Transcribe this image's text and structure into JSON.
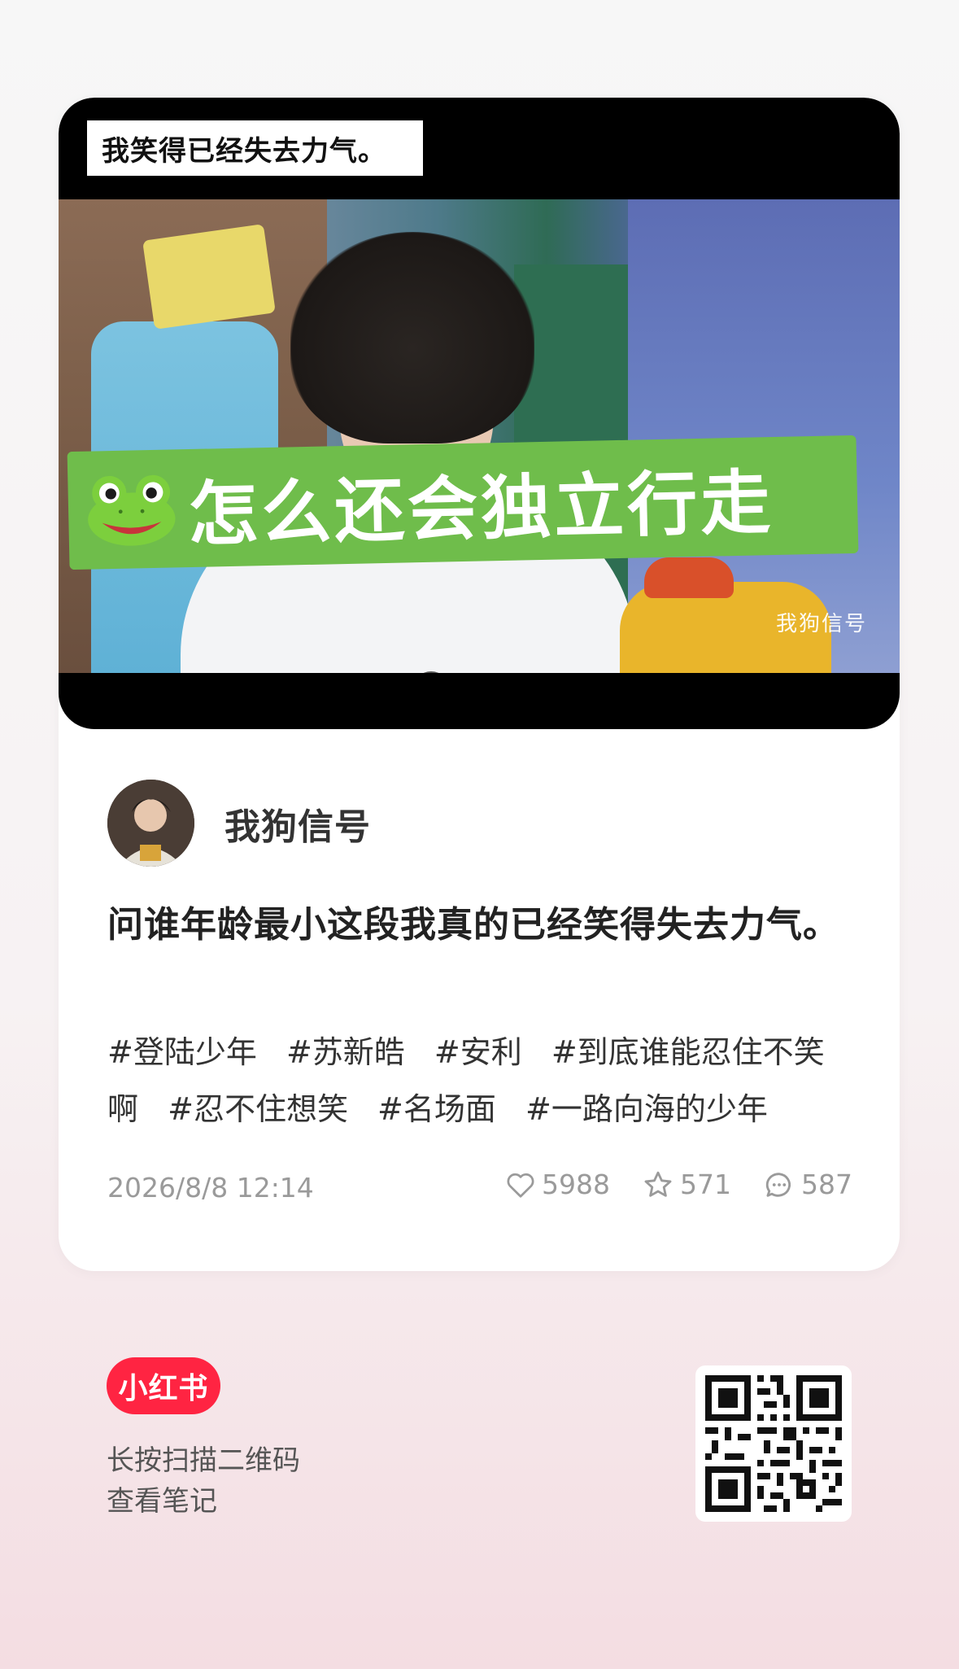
{
  "media": {
    "caption": "我笑得已经失去力气。",
    "banner_text": "怎么还会独立行走",
    "banner_icon": "frog-face-icon",
    "watermark": "我狗信号"
  },
  "author": {
    "name": "我狗信号"
  },
  "post": {
    "title": "问谁年龄最小这段我真的已经笑得失去力气。",
    "tags": [
      "#登陆少年",
      "#苏新皓",
      "#安利",
      "#到底谁能忍住不笑啊",
      "#忍不住想笑",
      "#名场面",
      "#一路向海的少年"
    ],
    "timestamp": "2026/8/8 12:14"
  },
  "stats": {
    "likes": "5988",
    "favorites": "571",
    "comments": "587"
  },
  "footer": {
    "brand": "小红书",
    "hint_line1": "长按扫描二维码",
    "hint_line2": "查看笔记"
  },
  "colors": {
    "brand_red": "#ff2442",
    "banner_green": "#6fbd4b",
    "muted_text": "#9a9a9a"
  }
}
